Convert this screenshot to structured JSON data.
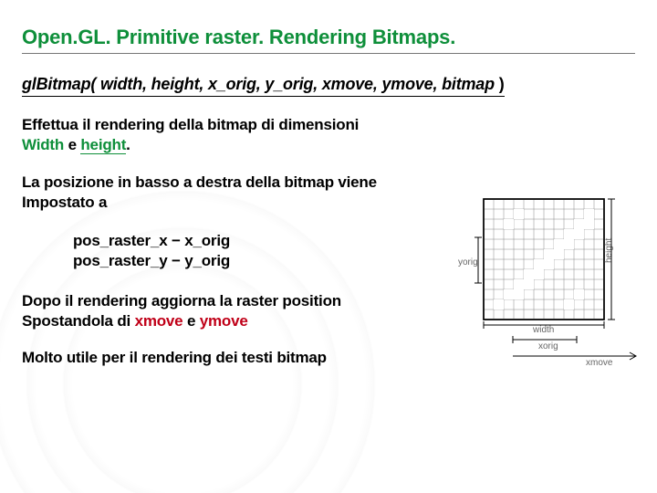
{
  "title": "Open.GL. Primitive raster. Rendering Bitmaps.",
  "signature": {
    "func": "glBitmap(",
    "args_italic": " width, height, x_orig, y_orig, xmove, ymove, bitmap",
    "close": " )"
  },
  "p1": {
    "t1": "Effettua il rendering della bitmap di dimensioni",
    "w": "Width",
    "e": " e ",
    "h": "height",
    "dot": "."
  },
  "p2": {
    "l1": "La posizione in basso a destra della bitmap viene",
    "l2": "Impostato a"
  },
  "formula": {
    "l1": "pos_raster_x − x_orig",
    "l2": "pos_raster_y − y_orig"
  },
  "p3": {
    "l1": "Dopo il rendering aggiorna la raster position",
    "l2a": "Spostandola di ",
    "xm": "xmove",
    "e": " e ",
    "ym": "ymove"
  },
  "p4": "Molto utile per il rendering dei testi bitmap",
  "diagram": {
    "labels": {
      "yorig": "yorig",
      "width": "width",
      "xorig": "xorig",
      "xmove": "xmove",
      "height": "height"
    }
  }
}
